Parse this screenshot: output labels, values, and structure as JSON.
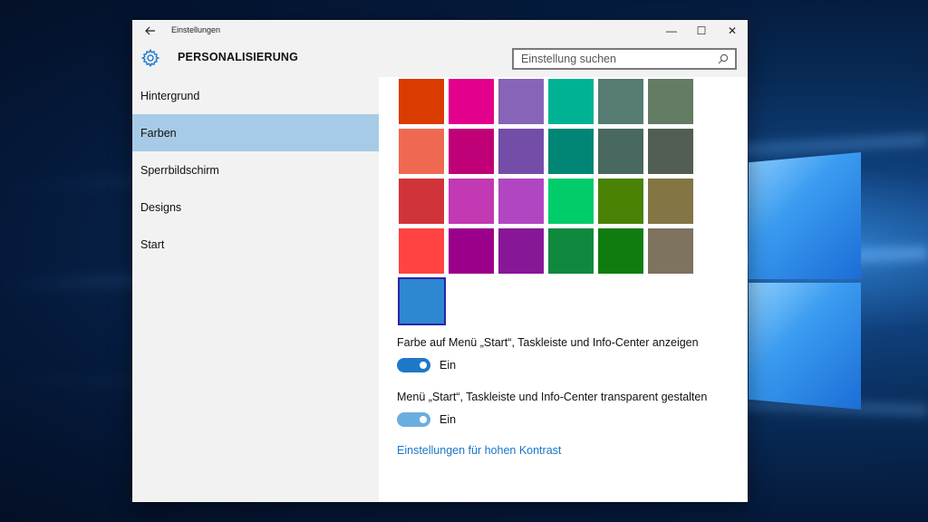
{
  "window": {
    "title": "Einstellungen",
    "back_icon": "back-arrow-icon",
    "minimize_glyph": "—",
    "maximize_glyph": "☐",
    "close_glyph": "✕"
  },
  "header": {
    "page_title": "PERSONALISIERUNG",
    "search_placeholder": "Einstellung suchen"
  },
  "sidebar": {
    "items": [
      {
        "label": "Hintergrund",
        "active": false
      },
      {
        "label": "Farben",
        "active": true
      },
      {
        "label": "Sperrbildschirm",
        "active": false
      },
      {
        "label": "Designs",
        "active": false
      },
      {
        "label": "Start",
        "active": false
      }
    ]
  },
  "colors": {
    "rows": [
      [
        "#da3b01",
        "#e3008c",
        "#8764b8",
        "#00b294",
        "#567c73",
        "#647c64"
      ],
      [
        "#ef6950",
        "#bf0077",
        "#744da9",
        "#018574",
        "#486860",
        "#525e54"
      ],
      [
        "#d13438",
        "#c239b3",
        "#b146c2",
        "#00cc6a",
        "#498205",
        "#847545"
      ],
      [
        "#ff4343",
        "#9a0089",
        "#881798",
        "#10893e",
        "#107c10",
        "#7e735f"
      ]
    ],
    "selected": "#2d87d1"
  },
  "settings": {
    "toggle1_label": "Farbe auf Menü „Start“, Taskleiste und Info-Center anzeigen",
    "toggle1_state": "Ein",
    "toggle1_color": "#1e78c8",
    "toggle2_label": "Menü „Start“, Taskleiste und Info-Center transparent gestalten",
    "toggle2_state": "Ein",
    "toggle2_color": "#6aaee0",
    "contrast_link": "Einstellungen für hohen Kontrast"
  }
}
